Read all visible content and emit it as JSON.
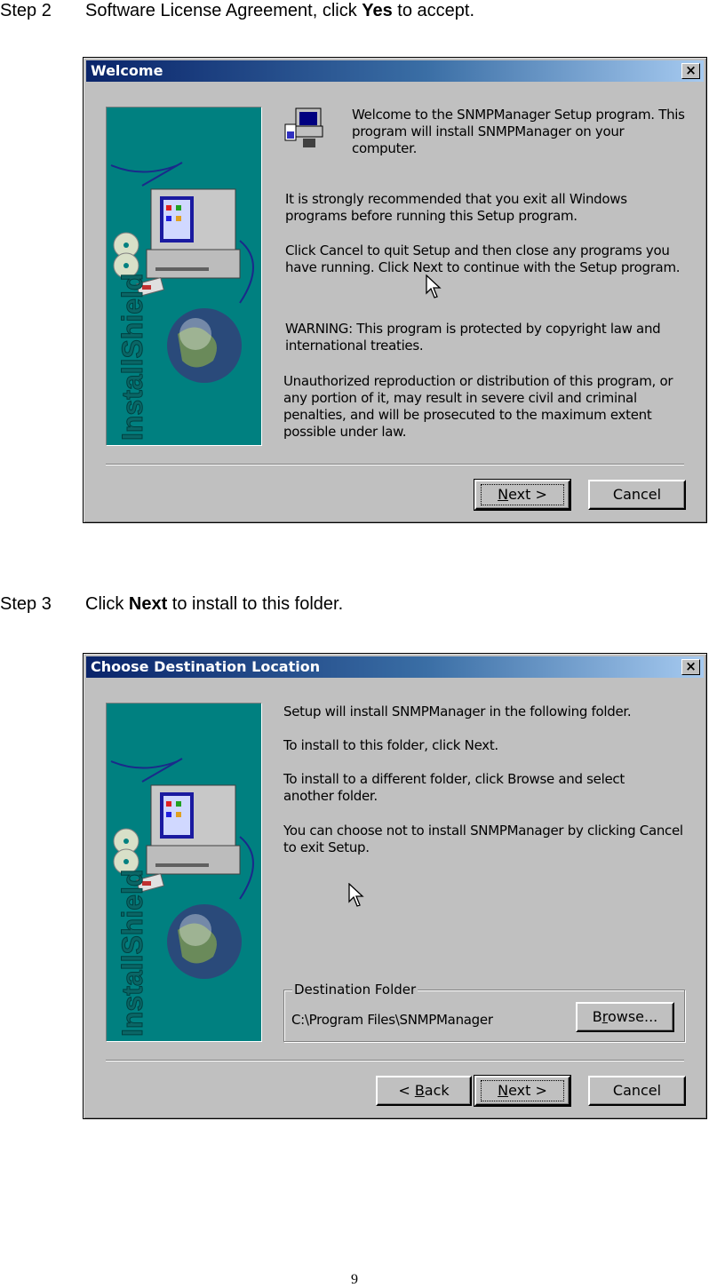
{
  "step2": {
    "number": "Step 2",
    "text_before": "Software License Agreement, click ",
    "text_bold": "Yes",
    "text_after": " to accept."
  },
  "welcome_dialog": {
    "title": "Welcome",
    "close_glyph": "×",
    "side_logo": "InstallShield",
    "intro": "Welcome to the SNMPManager Setup program.  This program will install SNMPManager on your computer.",
    "recommend": "It is strongly recommended that you exit all Windows programs before running this Setup program.",
    "cancel_info": "Click Cancel to quit Setup and then close any programs you have running.  Click Next to continue with the Setup program.",
    "warning": "WARNING: This program is protected by copyright law and international treaties.",
    "unauthorized": "Unauthorized reproduction or distribution of this program, or any portion of it, may result in severe civil and criminal penalties, and will be prosecuted to the maximum extent possible under law.",
    "next_mnemonic": "N",
    "next_rest": "ext >",
    "cancel_label": "Cancel"
  },
  "step3": {
    "number": "Step 3",
    "text_before": "Click ",
    "text_bold": "Next",
    "text_after": " to install to this folder."
  },
  "destination_dialog": {
    "title": "Choose Destination Location",
    "close_glyph": "×",
    "side_logo": "InstallShield",
    "line1": "Setup will install SNMPManager in the following folder.",
    "line2": "To install to this folder, click Next.",
    "line3": "To install to a different folder, click Browse and select another folder.",
    "line4": "You can choose not to install SNMPManager by clicking Cancel to exit Setup.",
    "group_label": "Destination Folder",
    "folder_path": "C:\\Program Files\\SNMPManager",
    "browse_pre": "B",
    "browse_mnemonic": "r",
    "browse_rest": "owse...",
    "back_pre": "< ",
    "back_mnemonic": "B",
    "back_rest": "ack",
    "next_mnemonic": "N",
    "next_rest": "ext >",
    "cancel_label": "Cancel"
  },
  "page_number": "9"
}
